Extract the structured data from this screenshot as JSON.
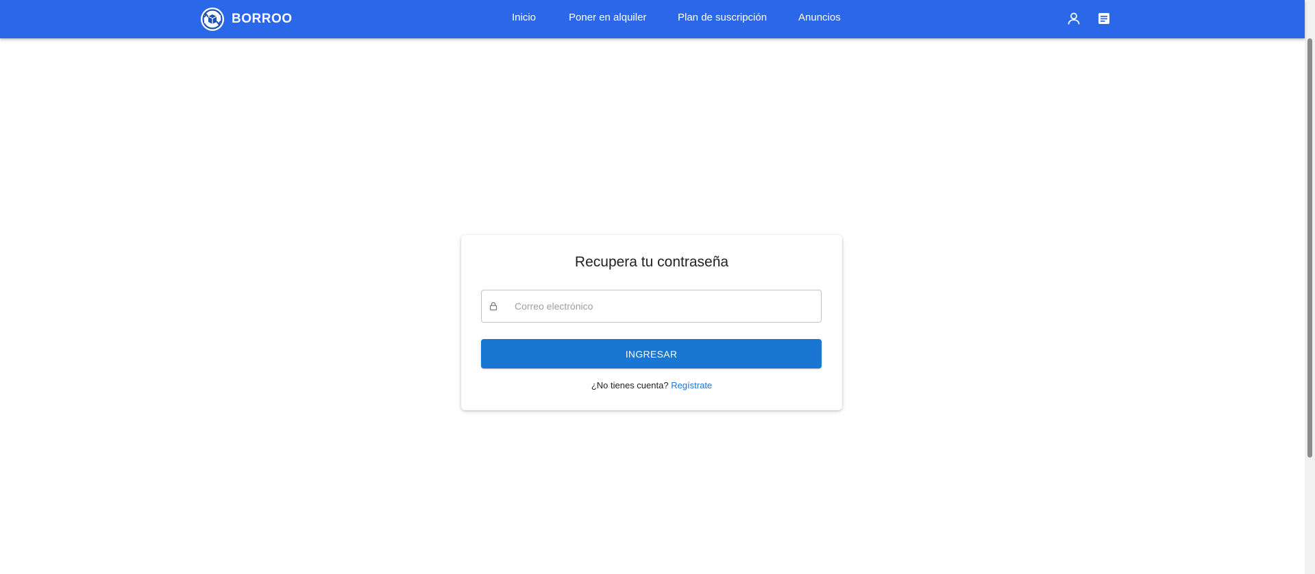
{
  "colors": {
    "header_bg": "#2b67e9",
    "primary_button": "#1976d2",
    "link": "#1976d2"
  },
  "header": {
    "brand_name": "BORROO",
    "logo_icon": "logo-recycle-box-icon",
    "nav": [
      {
        "label": "Inicio"
      },
      {
        "label": "Poner en alquiler"
      },
      {
        "label": "Plan de suscripción"
      },
      {
        "label": "Anuncios"
      }
    ],
    "icons": [
      "user-icon",
      "notes-icon"
    ]
  },
  "card": {
    "title": "Recupera tu contraseña",
    "email_placeholder": "Correo electrónico",
    "email_value": "",
    "field_icon": "lock-icon",
    "submit_label": "INGRESAR",
    "no_account_text": "¿No tienes cuenta?",
    "register_link": "Regístrate"
  }
}
